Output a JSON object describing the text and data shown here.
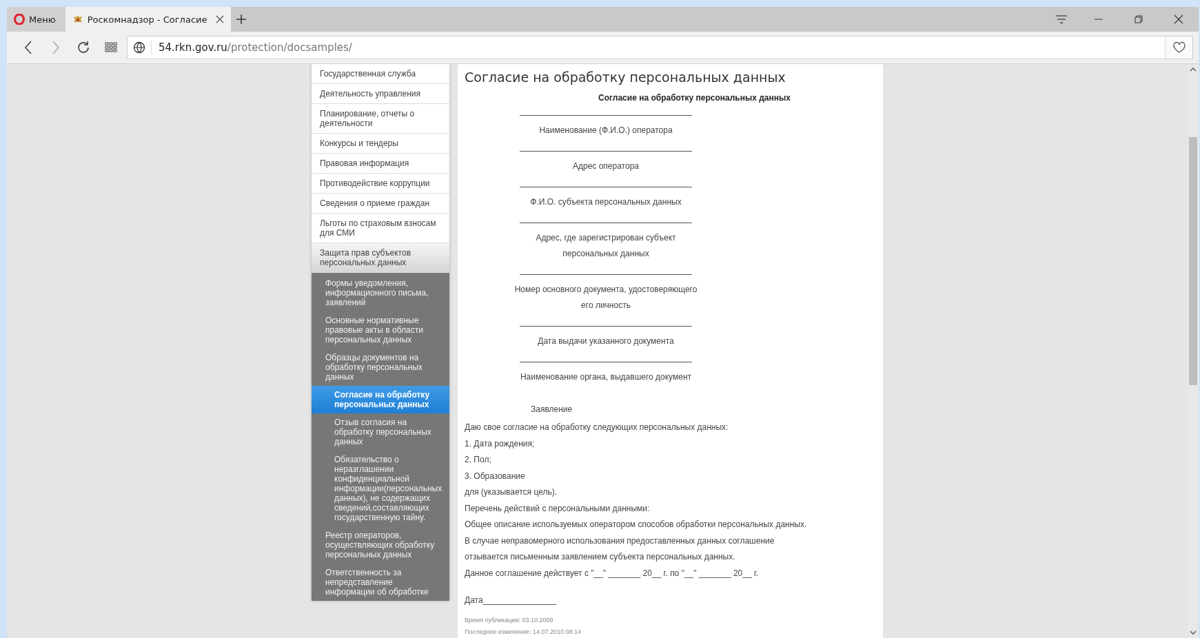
{
  "browser": {
    "menu_label": "Меню",
    "tab": {
      "title": "Роскомнадзор - Согласие",
      "selected": true
    },
    "address": {
      "host": "54.rkn.gov.ru",
      "path": "/protection/docsamples/"
    }
  },
  "sidebar": {
    "items": [
      {
        "label": "Государственная служба",
        "selected": false
      },
      {
        "label": "Деятельность управления",
        "selected": false
      },
      {
        "label": "Планирование, отчеты о деятельности",
        "selected": false
      },
      {
        "label": "Конкурсы и тендеры",
        "selected": false
      },
      {
        "label": "Правовая информация",
        "selected": false
      },
      {
        "label": "Противодействие коррупции",
        "selected": false
      },
      {
        "label": "Сведения о приеме граждан",
        "selected": false
      },
      {
        "label": "Льготы по страховым взносам для СМИ",
        "selected": false
      },
      {
        "label": "Защита прав субъектов персональных данных",
        "selected": false,
        "expanded": true,
        "children": [
          {
            "label": "Формы уведомления, информационного письма, заявлений",
            "selected": false
          },
          {
            "label": "Основные нормативные правовые акты в области персональных данных",
            "selected": false
          },
          {
            "label": "Образцы документов на обработку персональных данных",
            "selected": false,
            "expanded": true,
            "children": [
              {
                "label": "Согласие на обработку персональных данных",
                "selected": true
              },
              {
                "label": "Отзыв согласия на обработку персональных данных",
                "selected": false
              },
              {
                "label": "Обязательство о неразглашении конфиденциальной информации(персональных данных), не содержащих сведений,составляющих государственную тайну.",
                "selected": false
              }
            ]
          },
          {
            "label": "Реестр операторов, осуществляющих обработку персональных данных",
            "selected": false
          },
          {
            "label": "Ответственность за непредставление информации об обработке",
            "selected": false
          }
        ]
      }
    ]
  },
  "document": {
    "heading": "Согласие на обработку персональных данных",
    "title": "Согласие на обработку персональных данных",
    "fields": [
      [
        "Наименование (Ф.И.О.) оператора"
      ],
      [
        "Адрес оператора"
      ],
      [
        "Ф.И.О. субъекта персональных данных"
      ],
      [
        "Адрес, где зарегистрирован субъект",
        "персональных данных"
      ],
      [
        "Номер основного документа, удостоверяющего",
        "его личность"
      ],
      [
        "Дата выдачи указанного документа"
      ],
      [
        "Наименование органа, выдавшего документ"
      ]
    ],
    "statement_title": "Заявление",
    "paragraphs": [
      "Даю свое согласие на обработку следующих персональных данных:",
      "1. Дата рождения;",
      "2. Пол;",
      "3. Образование",
      "для (указывается цель).",
      "Перечень действий с персональными данными:",
      "Общее описание используемых оператором способов обработки персональных данных.",
      "В случае неправомерного использования предоставленных  данных соглашение",
      "отзывается письменным заявлением субъекта персональных данных.",
      "Данное соглашение действует с \"__\" _______ 20__ г. по \"__\" _______ 20__ г."
    ],
    "date_label": "Дата________________",
    "published": "Время публикации: 03.10.2009",
    "modified": "Последнее изменение: 14.07.2010 08:14"
  }
}
